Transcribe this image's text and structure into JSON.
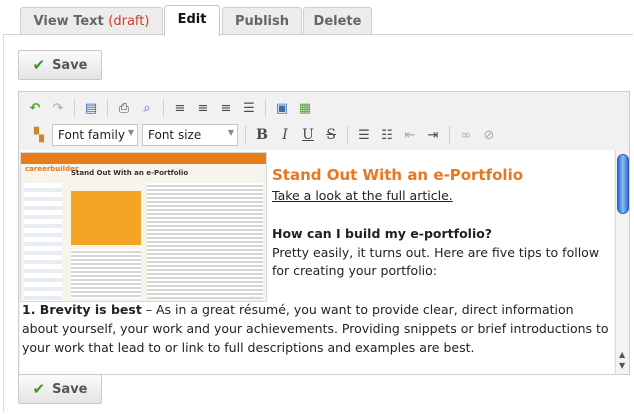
{
  "tabs": [
    {
      "label": "View Text",
      "suffix": "(draft)"
    },
    {
      "label": "Edit"
    },
    {
      "label": "Publish"
    },
    {
      "label": "Delete"
    }
  ],
  "buttons": {
    "save_label": "Save"
  },
  "toolbar": {
    "font_family": "Font family",
    "font_size": "Font size",
    "row1_icons": [
      "undo-icon",
      "redo-icon",
      "paste-from-word-icon",
      "print-icon",
      "find-replace-icon",
      "align-left-icon",
      "align-center-icon",
      "align-right-icon",
      "align-justify-icon",
      "insert-image-icon",
      "insert-media-icon"
    ],
    "row2_icons": [
      "styles-icon",
      "bold-icon",
      "italic-icon",
      "underline-icon",
      "strikethrough-icon",
      "bullet-list-icon",
      "numbered-list-icon",
      "outdent-icon",
      "indent-icon",
      "link-icon",
      "unlink-icon"
    ]
  },
  "content": {
    "title": "Stand Out With an e-Portfolio",
    "link_text": "Take a look at the full article.",
    "question": "How can I build my e-portfolio?",
    "paragraph1": "Pretty easily, it turns out. Here are five tips to follow for creating your portfolio:",
    "tip1_heading": "1. Brevity is best",
    "tip1_text": " – As in a great résumé, you want to provide clear, direct information about yourself, your work and your achievements. Providing snippets or brief introductions to your work that lead to or link to full descriptions and examples are best.",
    "thumbnail": {
      "site_logo": "careerbuilder",
      "headline": "Stand Out With an e-Portfolio"
    }
  },
  "colors": {
    "accent_orange": "#e87722",
    "draft_red": "#d33a2c",
    "save_check_green": "#3c9a1f",
    "scroll_blue": "#2f6fd8"
  }
}
